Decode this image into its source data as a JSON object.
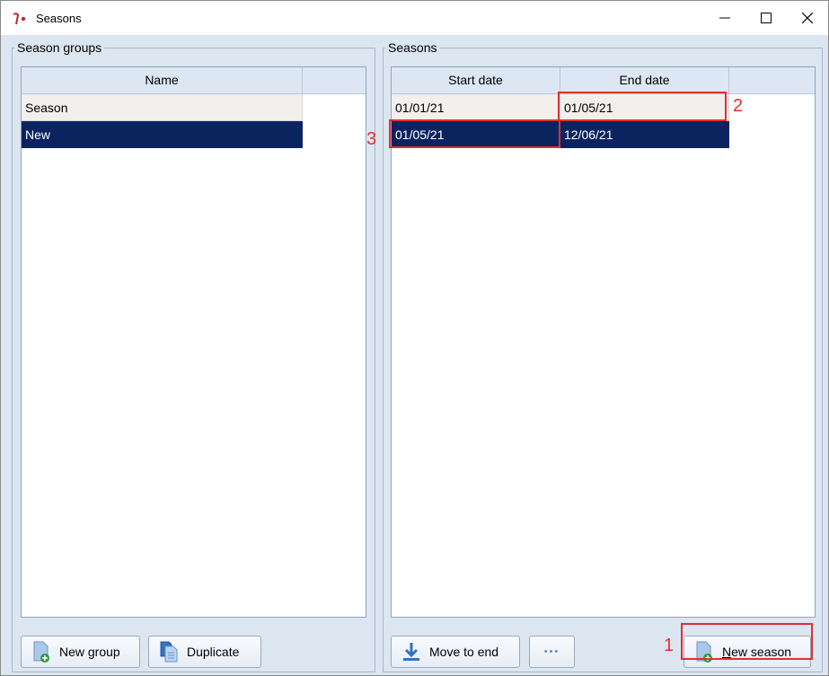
{
  "window": {
    "title": "Seasons",
    "icon": "app-logo-icon"
  },
  "left_panel": {
    "legend": "Season groups",
    "columns": [
      "Name"
    ],
    "rows": [
      {
        "name": "Season",
        "selected": false
      },
      {
        "name": "New",
        "selected": true
      }
    ],
    "buttons": {
      "new_group": "New group",
      "duplicate": "Duplicate"
    }
  },
  "right_panel": {
    "legend": "Seasons",
    "columns": [
      "Start date",
      "End date"
    ],
    "rows": [
      {
        "start": "01/01/21",
        "end": "01/05/21",
        "selected": false
      },
      {
        "start": "01/05/21",
        "end": "12/06/21",
        "selected": true
      }
    ],
    "buttons": {
      "move_to_end": "Move to end",
      "more": "•••",
      "new_season_mnemonic": "N",
      "new_season_rest": "ew season"
    }
  },
  "annotations": {
    "one": "1",
    "two": "2",
    "three": "3",
    "color": "#e03030"
  },
  "colors": {
    "selection": "#0b2460",
    "client_bg": "#dce6f1",
    "header_bg": "#dde7f3"
  }
}
